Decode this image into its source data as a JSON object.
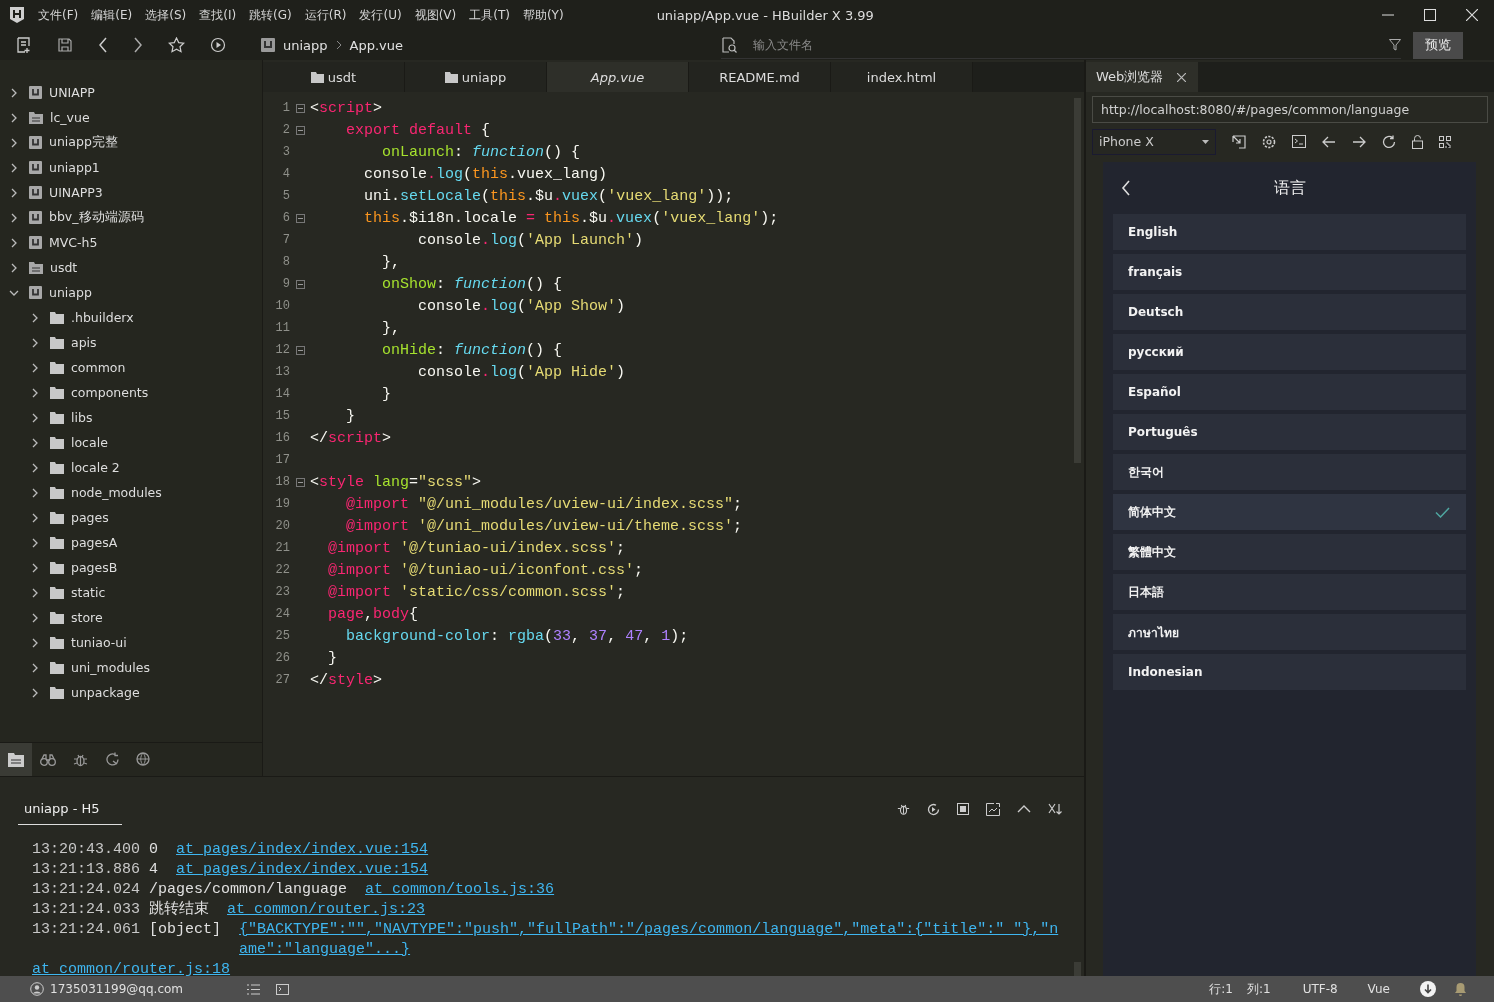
{
  "window": {
    "title": "uniapp/App.vue - HBuilder X 3.99"
  },
  "menu": [
    "文件(F)",
    "编辑(E)",
    "选择(S)",
    "查找(I)",
    "跳转(G)",
    "运行(R)",
    "发行(U)",
    "视图(V)",
    "工具(T)",
    "帮助(Y)"
  ],
  "breadcrumb": [
    "uniapp",
    "App.vue"
  ],
  "file_search": {
    "placeholder": "输入文件名"
  },
  "preview_button": "预览",
  "project_tree": [
    {
      "label": "UNIAPP",
      "kind": "project",
      "expanded": false
    },
    {
      "label": "lc_vue",
      "kind": "web",
      "expanded": false
    },
    {
      "label": "uniapp完整",
      "kind": "project",
      "expanded": false
    },
    {
      "label": "uniapp1",
      "kind": "project",
      "expanded": false
    },
    {
      "label": "UINAPP3",
      "kind": "project",
      "expanded": false
    },
    {
      "label": "bbv_移动端源码",
      "kind": "project",
      "expanded": false
    },
    {
      "label": "MVC-h5",
      "kind": "project",
      "expanded": false
    },
    {
      "label": "usdt",
      "kind": "web",
      "expanded": false
    },
    {
      "label": "uniapp",
      "kind": "project",
      "expanded": true,
      "children": [
        {
          "label": ".hbuilderx",
          "kind": "folder",
          "expanded": false
        },
        {
          "label": "apis",
          "kind": "folder",
          "expanded": false
        },
        {
          "label": "common",
          "kind": "folder",
          "expanded": false
        },
        {
          "label": "components",
          "kind": "folder",
          "expanded": false
        },
        {
          "label": "libs",
          "kind": "folder",
          "expanded": false
        },
        {
          "label": "locale",
          "kind": "folder",
          "expanded": false
        },
        {
          "label": "locale 2",
          "kind": "folder",
          "expanded": false
        },
        {
          "label": "node_modules",
          "kind": "folder",
          "expanded": false
        },
        {
          "label": "pages",
          "kind": "folder",
          "expanded": false
        },
        {
          "label": "pagesA",
          "kind": "folder",
          "expanded": false
        },
        {
          "label": "pagesB",
          "kind": "folder",
          "expanded": false
        },
        {
          "label": "static",
          "kind": "folder",
          "expanded": false
        },
        {
          "label": "store",
          "kind": "folder",
          "expanded": false
        },
        {
          "label": "tuniao-ui",
          "kind": "folder",
          "expanded": false
        },
        {
          "label": "uni_modules",
          "kind": "folder",
          "expanded": false
        },
        {
          "label": "unpackage",
          "kind": "folder",
          "expanded": false
        }
      ]
    }
  ],
  "sidebar_tabs": [
    {
      "kind": "files",
      "selected": true
    },
    {
      "kind": "binoculars",
      "selected": false
    },
    {
      "kind": "bug",
      "selected": false
    },
    {
      "kind": "refresh",
      "selected": false
    },
    {
      "kind": "globe",
      "selected": false
    }
  ],
  "editor_tabs": [
    {
      "label": "usdt",
      "kind": "folder",
      "selected": false
    },
    {
      "label": "uniapp",
      "kind": "folder",
      "selected": false
    },
    {
      "label": "App.vue",
      "kind": "file",
      "selected": true
    },
    {
      "label": "README.md",
      "kind": "file",
      "selected": false
    },
    {
      "label": "index.html",
      "kind": "file",
      "selected": false
    }
  ],
  "code_lines": [
    {
      "number": "1",
      "fold": true,
      "tokens": [
        {
          "kind": "plain",
          "text": "<"
        },
        {
          "kind": "tag",
          "text": "script"
        },
        {
          "kind": "plain",
          "text": ">"
        }
      ]
    },
    {
      "number": "2",
      "fold": true,
      "tokens": [
        {
          "kind": "kw",
          "text": "    export default"
        },
        {
          "kind": "plain",
          "text": " {"
        }
      ]
    },
    {
      "number": "3",
      "fold": false,
      "tokens": [
        {
          "kind": "key",
          "text": "        onLaunch"
        },
        {
          "kind": "plain",
          "text": ": "
        },
        {
          "kind": "fn",
          "text": "function"
        },
        {
          "kind": "plain",
          "text": "() {"
        }
      ]
    },
    {
      "number": "4",
      "fold": false,
      "tokens": [
        {
          "kind": "plain",
          "text": "      console"
        },
        {
          "kind": "op",
          "text": "."
        },
        {
          "kind": "call",
          "text": "log"
        },
        {
          "kind": "plain",
          "text": "("
        },
        {
          "kind": "this",
          "text": "this"
        },
        {
          "kind": "plain",
          "text": ".vuex_lang)"
        }
      ]
    },
    {
      "number": "5",
      "fold": false,
      "tokens": [
        {
          "kind": "plain",
          "text": "      uni."
        },
        {
          "kind": "call",
          "text": "setLocale"
        },
        {
          "kind": "plain",
          "text": "("
        },
        {
          "kind": "this",
          "text": "this"
        },
        {
          "kind": "plain",
          "text": ".$u"
        },
        {
          "kind": "op",
          "text": "."
        },
        {
          "kind": "call",
          "text": "vuex"
        },
        {
          "kind": "plain",
          "text": "("
        },
        {
          "kind": "str",
          "text": "'vuex_lang'"
        },
        {
          "kind": "plain",
          "text": "));"
        }
      ]
    },
    {
      "number": "6",
      "fold": true,
      "tokens": [
        {
          "kind": "this",
          "text": "      this"
        },
        {
          "kind": "plain",
          "text": ".$i18n.locale "
        },
        {
          "kind": "op",
          "text": "= "
        },
        {
          "kind": "this",
          "text": "this"
        },
        {
          "kind": "plain",
          "text": ".$u"
        },
        {
          "kind": "op",
          "text": "."
        },
        {
          "kind": "call",
          "text": "vuex"
        },
        {
          "kind": "plain",
          "text": "("
        },
        {
          "kind": "str",
          "text": "'vuex_lang'"
        },
        {
          "kind": "plain",
          "text": ");"
        }
      ]
    },
    {
      "number": "7",
      "fold": false,
      "tokens": [
        {
          "kind": "plain",
          "text": "            console"
        },
        {
          "kind": "op",
          "text": "."
        },
        {
          "kind": "call",
          "text": "log"
        },
        {
          "kind": "plain",
          "text": "("
        },
        {
          "kind": "str",
          "text": "'App Launch'"
        },
        {
          "kind": "plain",
          "text": ")"
        }
      ]
    },
    {
      "number": "8",
      "fold": false,
      "tokens": [
        {
          "kind": "plain",
          "text": "        },"
        }
      ]
    },
    {
      "number": "9",
      "fold": true,
      "tokens": [
        {
          "kind": "key",
          "text": "        onShow"
        },
        {
          "kind": "plain",
          "text": ": "
        },
        {
          "kind": "fn",
          "text": "function"
        },
        {
          "kind": "plain",
          "text": "() {"
        }
      ]
    },
    {
      "number": "10",
      "fold": false,
      "tokens": [
        {
          "kind": "plain",
          "text": "            console"
        },
        {
          "kind": "op",
          "text": "."
        },
        {
          "kind": "call",
          "text": "log"
        },
        {
          "kind": "plain",
          "text": "("
        },
        {
          "kind": "str",
          "text": "'App Show'"
        },
        {
          "kind": "plain",
          "text": ")"
        }
      ]
    },
    {
      "number": "11",
      "fold": false,
      "tokens": [
        {
          "kind": "plain",
          "text": "        },"
        }
      ]
    },
    {
      "number": "12",
      "fold": true,
      "tokens": [
        {
          "kind": "key",
          "text": "        onHide"
        },
        {
          "kind": "plain",
          "text": ": "
        },
        {
          "kind": "fn",
          "text": "function"
        },
        {
          "kind": "plain",
          "text": "() {"
        }
      ]
    },
    {
      "number": "13",
      "fold": false,
      "tokens": [
        {
          "kind": "plain",
          "text": "            console"
        },
        {
          "kind": "op",
          "text": "."
        },
        {
          "kind": "call",
          "text": "log"
        },
        {
          "kind": "plain",
          "text": "("
        },
        {
          "kind": "str",
          "text": "'App Hide'"
        },
        {
          "kind": "plain",
          "text": ")"
        }
      ]
    },
    {
      "number": "14",
      "fold": false,
      "tokens": [
        {
          "kind": "plain",
          "text": "        }"
        }
      ]
    },
    {
      "number": "15",
      "fold": false,
      "tokens": [
        {
          "kind": "plain",
          "text": "    }"
        }
      ]
    },
    {
      "number": "16",
      "fold": false,
      "tokens": [
        {
          "kind": "plain",
          "text": "</"
        },
        {
          "kind": "tag",
          "text": "script"
        },
        {
          "kind": "plain",
          "text": ">"
        }
      ]
    },
    {
      "number": "17",
      "fold": false
    },
    {
      "number": "18",
      "fold": true,
      "tokens": [
        {
          "kind": "plain",
          "text": "<"
        },
        {
          "kind": "tag",
          "text": "style"
        },
        {
          "kind": "key",
          "text": " lang"
        },
        {
          "kind": "plain",
          "text": "="
        },
        {
          "kind": "str",
          "text": "\"scss\""
        },
        {
          "kind": "plain",
          "text": ">"
        }
      ]
    },
    {
      "number": "19",
      "fold": false,
      "tokens": [
        {
          "kind": "at",
          "text": "    @import"
        },
        {
          "kind": "str",
          "text": " \"@/uni_modules/uview-ui/index.scss\""
        },
        {
          "kind": "plain",
          "text": ";"
        }
      ]
    },
    {
      "number": "20",
      "fold": false,
      "tokens": [
        {
          "kind": "at",
          "text": "    @import"
        },
        {
          "kind": "str",
          "text": " '@/uni_modules/uview-ui/theme.scss'"
        },
        {
          "kind": "plain",
          "text": ";"
        }
      ]
    },
    {
      "number": "21",
      "fold": false,
      "tokens": [
        {
          "kind": "at",
          "text": "  @import"
        },
        {
          "kind": "str",
          "text": " '@/tuniao-ui/index.scss'"
        },
        {
          "kind": "plain",
          "text": ";"
        }
      ]
    },
    {
      "number": "22",
      "fold": false,
      "tokens": [
        {
          "kind": "at",
          "text": "  @import"
        },
        {
          "kind": "str",
          "text": " '@/tuniao-ui/iconfont.css'"
        },
        {
          "kind": "plain",
          "text": ";"
        }
      ]
    },
    {
      "number": "23",
      "fold": false,
      "tokens": [
        {
          "kind": "at",
          "text": "  @import"
        },
        {
          "kind": "str",
          "text": " 'static/css/common.scss'"
        },
        {
          "kind": "plain",
          "text": ";"
        }
      ]
    },
    {
      "number": "24",
      "fold": false,
      "tokens": [
        {
          "kind": "tag",
          "text": "  page"
        },
        {
          "kind": "plain",
          "text": ","
        },
        {
          "kind": "tag",
          "text": "body"
        },
        {
          "kind": "plain",
          "text": "{"
        }
      ]
    },
    {
      "number": "25",
      "fold": false,
      "tokens": [
        {
          "kind": "call",
          "text": "    background-color"
        },
        {
          "kind": "plain",
          "text": ": "
        },
        {
          "kind": "call",
          "text": "rgba"
        },
        {
          "kind": "plain",
          "text": "("
        },
        {
          "kind": "num",
          "text": "33"
        },
        {
          "kind": "plain",
          "text": ", "
        },
        {
          "kind": "num",
          "text": "37"
        },
        {
          "kind": "plain",
          "text": ", "
        },
        {
          "kind": "num",
          "text": "47"
        },
        {
          "kind": "plain",
          "text": ", "
        },
        {
          "kind": "num",
          "text": "1"
        },
        {
          "kind": "plain",
          "text": ");"
        }
      ]
    },
    {
      "number": "26",
      "fold": false,
      "tokens": [
        {
          "kind": "plain",
          "text": "  }"
        }
      ]
    },
    {
      "number": "27",
      "fold": false,
      "tokens": [
        {
          "kind": "plain",
          "text": "</"
        },
        {
          "kind": "tag",
          "text": "style"
        },
        {
          "kind": "plain",
          "text": ">"
        }
      ]
    }
  ],
  "browser": {
    "tab": "Web浏览器",
    "url": "http://localhost:8080/#/pages/common/language",
    "device": "iPhone X",
    "page_title": "语言",
    "languages": [
      {
        "label": "English",
        "selected": false
      },
      {
        "label": "français",
        "selected": false
      },
      {
        "label": "Deutsch",
        "selected": false
      },
      {
        "label": "русский",
        "selected": false
      },
      {
        "label": "Español",
        "selected": false
      },
      {
        "label": "Português",
        "selected": false
      },
      {
        "label": "한국어",
        "selected": false
      },
      {
        "label": "简体中文",
        "selected": true
      },
      {
        "label": "繁體中文",
        "selected": false
      },
      {
        "label": "日本語",
        "selected": false
      },
      {
        "label": "ภาษาไทย",
        "selected": false
      },
      {
        "label": "Indonesian",
        "selected": false
      }
    ]
  },
  "console": {
    "tab": "uniapp - H5",
    "lines": [
      {
        "time": "13:20:43.400",
        "parts": [
          {
            "kind": "text",
            "text": "0"
          },
          {
            "kind": "source",
            "text": "at pages/index/index.vue:154"
          }
        ]
      },
      {
        "time": "13:21:13.886",
        "parts": [
          {
            "kind": "text",
            "text": "4"
          },
          {
            "kind": "source",
            "text": "at pages/index/index.vue:154"
          }
        ]
      },
      {
        "time": "13:21:24.024",
        "parts": [
          {
            "kind": "text",
            "text": "/pages/common/language"
          },
          {
            "kind": "source",
            "text": "at common/tools.js:36"
          }
        ]
      },
      {
        "time": "13:21:24.033",
        "parts": [
          {
            "kind": "text",
            "text": "跳转结束"
          },
          {
            "kind": "source",
            "text": "at common/router.js:23"
          }
        ]
      },
      {
        "time": "13:21:24.061",
        "parts": [
          {
            "kind": "text",
            "text": "[object]"
          },
          {
            "kind": "object",
            "text": "{\"BACKTYPE\":\"\",\"NAVTYPE\":\"push\",\"fullPath\":\"/pages/common/language\",\"meta\":{\"title\":\" \"},\"name\":\"language\"...}"
          },
          {
            "kind": "source",
            "text": "at common/router.js:18"
          }
        ]
      }
    ]
  },
  "status_bar": {
    "account": "1735031199@qq.com",
    "line": "行:1",
    "column": "列:1",
    "encoding": "UTF-8",
    "language": "Vue"
  }
}
